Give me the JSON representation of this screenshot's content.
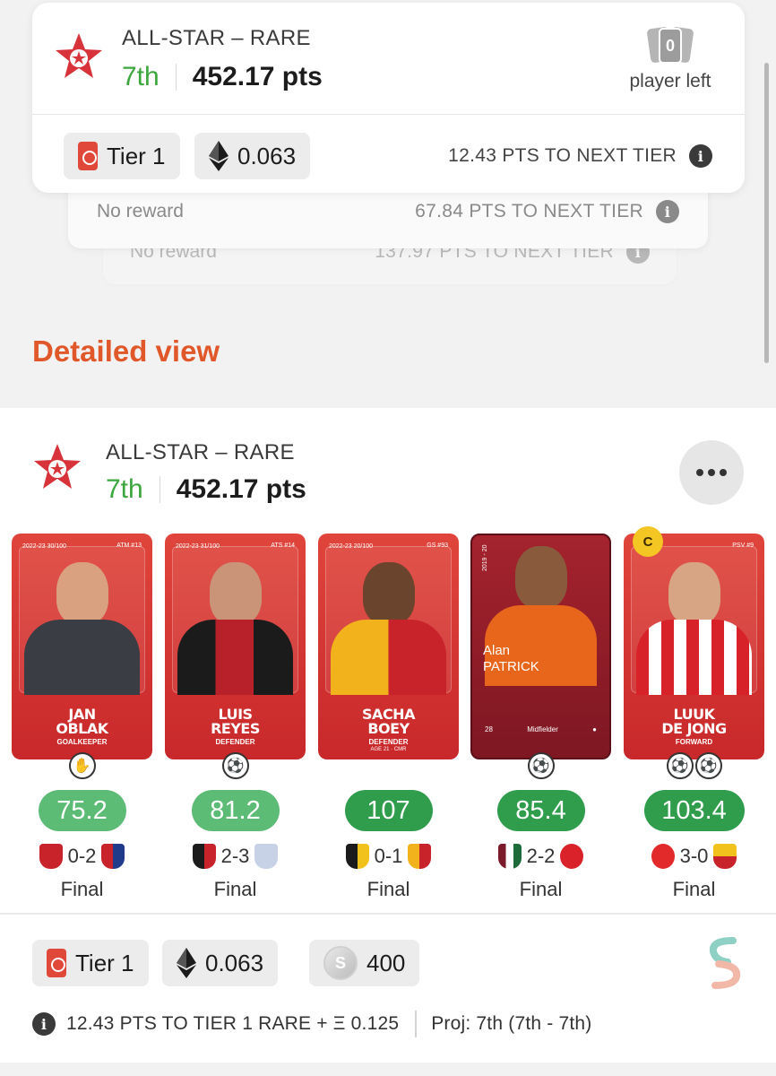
{
  "summary": {
    "title": "ALL-STAR – RARE",
    "rank": "7th",
    "points": "452.17 pts",
    "players_left_count": "0",
    "players_left_label": "player left",
    "tier_label": "Tier 1",
    "eth_value": "0.063",
    "next_tier": "12.43 PTS TO NEXT TIER",
    "stacked_tiers": [
      {
        "reward": "No reward",
        "next": "67.84 PTS TO NEXT TIER"
      },
      {
        "reward": "No reward",
        "next": "137.97 PTS TO NEXT TIER"
      }
    ]
  },
  "detailed_view_label": "Detailed view",
  "lineup": {
    "title": "ALL-STAR – RARE",
    "rank": "7th",
    "points": "452.17 pts",
    "players": [
      {
        "first": "JAN",
        "last": "OBLAK",
        "position": "GOALKEEPER",
        "season": "2022-23\n30/100",
        "club": "ATM #13",
        "score": "75.2",
        "home_score": "0-2",
        "result": "Final",
        "action_icon": "goalkeeper-glove-icon"
      },
      {
        "first": "LUIS",
        "last": "REYES",
        "position": "DEFENDER",
        "season": "2022-23\n31/100",
        "club": "ATS #14",
        "score": "81.2",
        "home_score": "2-3",
        "result": "Final",
        "action_icon": "ball-icon"
      },
      {
        "first": "SACHA",
        "last": "BOEY",
        "position": "DEFENDER",
        "sub": "AGE 21 · CMR",
        "season": "2022-23\n20/100",
        "club": "GS #93",
        "score": "107",
        "home_score": "0-1",
        "result": "Final",
        "action_icon": "ball-icon"
      },
      {
        "first": "Alan",
        "last": "PATRICK",
        "position": "Midfielder",
        "season": "2019 - 20",
        "club": "",
        "score": "85.4",
        "home_score": "2-2",
        "result": "Final",
        "action_icon": "ball-icon",
        "stat_age": "28"
      },
      {
        "first": "LUUK",
        "last": "DE JONG",
        "position": "FORWARD",
        "season": "2022-23",
        "club": "PSV #9",
        "score": "103.4",
        "home_score": "3-0",
        "result": "Final",
        "action_icon": "two-balls-icon",
        "captain": "C"
      }
    ],
    "rewards": {
      "tier_label": "Tier 1",
      "eth_value": "0.063",
      "coins": "400"
    },
    "footer_next": "12.43 PTS TO TIER 1 RARE + Ξ 0.125",
    "footer_proj": "Proj: 7th (7th - 7th)"
  },
  "colors": {
    "accent": "#e0582a",
    "rank_green": "#3aa63c",
    "card_red": "#d23a33",
    "score_light": "#5cbc75",
    "score_dark": "#2f9d4c"
  }
}
